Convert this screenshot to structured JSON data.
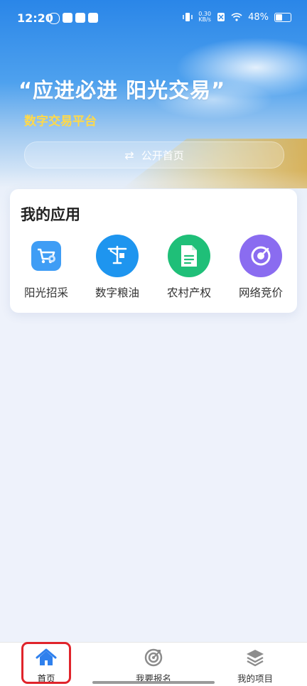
{
  "status_bar": {
    "time": "12:20",
    "net_speed_value": "0.30",
    "net_speed_unit": "KB/s",
    "battery": "48%"
  },
  "hero": {
    "slogan": "“应进必进 阳光交易”",
    "subtitle": "数字交易平台",
    "public_home_label": "公开首页",
    "swap_glyph": "⇄"
  },
  "my_apps": {
    "title": "我的应用",
    "items": [
      {
        "label": "阳光招采",
        "icon": "shopping-cart-icon",
        "color": "#2f8ef0"
      },
      {
        "label": "数字粮油",
        "icon": "crane-icon",
        "color": "#1e95ef"
      },
      {
        "label": "农村产权",
        "icon": "document-icon",
        "color": "#1fbf78"
      },
      {
        "label": "网络竞价",
        "icon": "target-icon",
        "color": "#8a6cf0"
      }
    ]
  },
  "tabbar": {
    "items": [
      {
        "label": "首页",
        "icon": "home-icon",
        "active": true
      },
      {
        "label": "我要报名",
        "icon": "target-icon"
      },
      {
        "label": "我的项目",
        "icon": "layers-icon"
      }
    ]
  },
  "colors": {
    "accent_blue": "#2f80ed",
    "subtitle_yellow": "#ffd94a",
    "highlight_red": "#e0242b"
  }
}
